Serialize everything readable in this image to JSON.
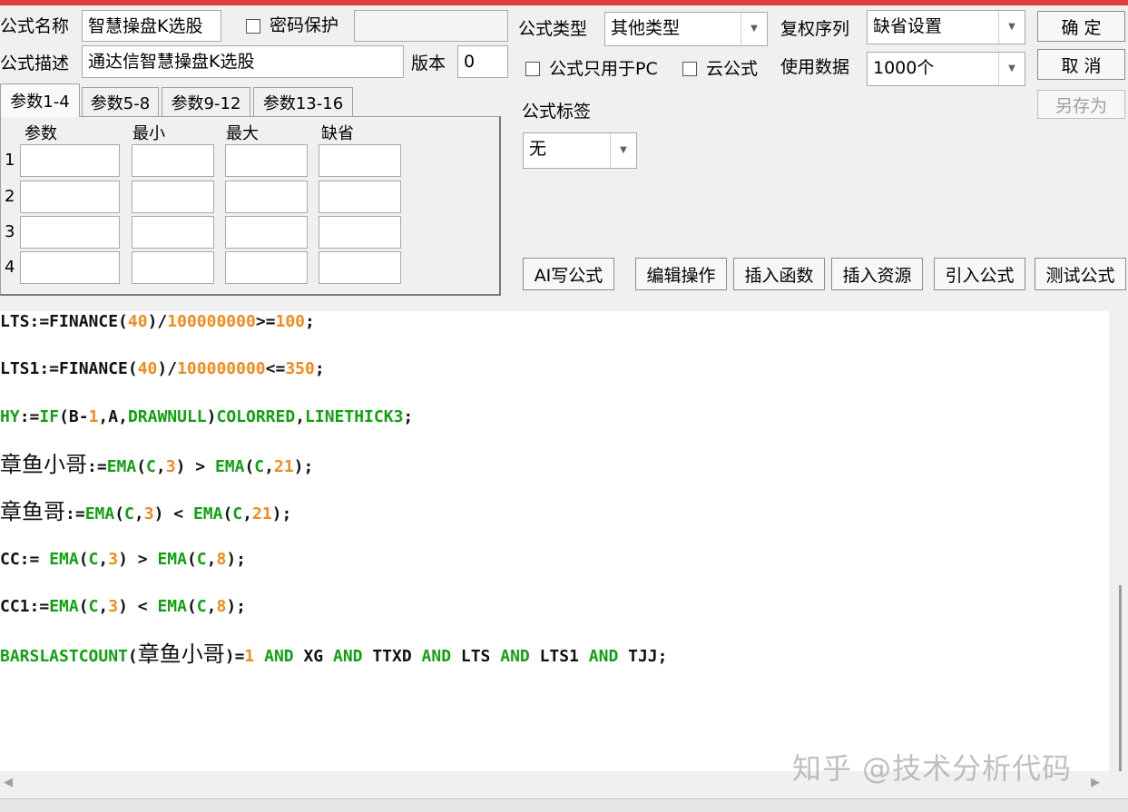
{
  "form": {
    "name_label": "公式名称",
    "name_value": "智慧操盘K选股",
    "password_label": "密码保护",
    "desc_label": "公式描述",
    "desc_value": "通达信智慧操盘K选股",
    "version_label": "版本",
    "version_value": "0",
    "type_label": "公式类型",
    "type_value": "其他类型",
    "fq_label": "复权序列",
    "fq_value": "缺省设置",
    "pc_only_label": "公式只用于PC",
    "cloud_label": "云公式",
    "data_label": "使用数据",
    "data_value": "1000个",
    "tag_label": "公式标签",
    "tag_value": "无"
  },
  "buttons": {
    "ok": "确  定",
    "cancel": "取  消",
    "save_as": "另存为",
    "ai_write": "AI写公式",
    "edit_ops": "编辑操作",
    "insert_func": "插入函数",
    "insert_res": "插入资源",
    "import_formula": "引入公式",
    "test_formula": "测试公式"
  },
  "tabs": [
    "参数1-4",
    "参数5-8",
    "参数9-12",
    "参数13-16"
  ],
  "params": {
    "headers": [
      "参数",
      "最小",
      "最大",
      "缺省"
    ],
    "rows": [
      "1",
      "2",
      "3",
      "4"
    ]
  },
  "code": [
    [
      [
        "p",
        "LTS:=FINANCE("
      ],
      [
        "n",
        "40"
      ],
      [
        "p",
        ")/"
      ],
      [
        "n",
        "100000000"
      ],
      [
        "p",
        ">="
      ],
      [
        "n",
        "100"
      ],
      [
        "p",
        ";"
      ]
    ],
    [
      [
        "p",
        "LTS1:=FINANCE("
      ],
      [
        "n",
        "40"
      ],
      [
        "p",
        ")/"
      ],
      [
        "n",
        "100000000"
      ],
      [
        "p",
        "<="
      ],
      [
        "n",
        "350"
      ],
      [
        "p",
        ";"
      ]
    ],
    [
      [
        "f",
        "HY"
      ],
      [
        "p",
        ":="
      ],
      [
        "f",
        "IF"
      ],
      [
        "p",
        "(B-"
      ],
      [
        "n",
        "1"
      ],
      [
        "p",
        ",A,"
      ],
      [
        "f",
        "DRAWNULL"
      ],
      [
        "p",
        ")"
      ],
      [
        "f",
        "COLORRED"
      ],
      [
        "p",
        ","
      ],
      [
        "f",
        "LINETHICK3"
      ],
      [
        "p",
        ";"
      ]
    ],
    [
      [
        "c",
        "章鱼小哥"
      ],
      [
        "p",
        ":="
      ],
      [
        "f",
        "EMA"
      ],
      [
        "p",
        "("
      ],
      [
        "f",
        "C"
      ],
      [
        "p",
        ","
      ],
      [
        "n",
        "3"
      ],
      [
        "p",
        ") > "
      ],
      [
        "f",
        "EMA"
      ],
      [
        "p",
        "("
      ],
      [
        "f",
        "C"
      ],
      [
        "p",
        ","
      ],
      [
        "n",
        "21"
      ],
      [
        "p",
        ");"
      ]
    ],
    [
      [
        "c",
        "章鱼哥"
      ],
      [
        "p",
        ":="
      ],
      [
        "f",
        "EMA"
      ],
      [
        "p",
        "("
      ],
      [
        "f",
        "C"
      ],
      [
        "p",
        ","
      ],
      [
        "n",
        "3"
      ],
      [
        "p",
        ") < "
      ],
      [
        "f",
        "EMA"
      ],
      [
        "p",
        "("
      ],
      [
        "f",
        "C"
      ],
      [
        "p",
        ","
      ],
      [
        "n",
        "21"
      ],
      [
        "p",
        ");"
      ]
    ],
    [
      [
        "p",
        "CC:= "
      ],
      [
        "f",
        "EMA"
      ],
      [
        "p",
        "("
      ],
      [
        "f",
        "C"
      ],
      [
        "p",
        ","
      ],
      [
        "n",
        "3"
      ],
      [
        "p",
        ") > "
      ],
      [
        "f",
        "EMA"
      ],
      [
        "p",
        "("
      ],
      [
        "f",
        "C"
      ],
      [
        "p",
        ","
      ],
      [
        "n",
        "8"
      ],
      [
        "p",
        ");"
      ]
    ],
    [
      [
        "p",
        "CC1:="
      ],
      [
        "f",
        "EMA"
      ],
      [
        "p",
        "("
      ],
      [
        "f",
        "C"
      ],
      [
        "p",
        ","
      ],
      [
        "n",
        "3"
      ],
      [
        "p",
        ") < "
      ],
      [
        "f",
        "EMA"
      ],
      [
        "p",
        "("
      ],
      [
        "f",
        "C"
      ],
      [
        "p",
        ","
      ],
      [
        "n",
        "8"
      ],
      [
        "p",
        ");"
      ]
    ],
    [
      [
        "f",
        "BARSLASTCOUNT"
      ],
      [
        "p",
        "("
      ],
      [
        "c",
        "章鱼小哥"
      ],
      [
        "p",
        ")="
      ],
      [
        "n",
        "1"
      ],
      [
        "p",
        " "
      ],
      [
        "f",
        "AND"
      ],
      [
        "p",
        " XG "
      ],
      [
        "f",
        "AND"
      ],
      [
        "p",
        " TTXD "
      ],
      [
        "f",
        "AND"
      ],
      [
        "p",
        " LTS "
      ],
      [
        "f",
        "AND"
      ],
      [
        "p",
        " LTS1 "
      ],
      [
        "f",
        "AND"
      ],
      [
        "p",
        " TJJ;"
      ]
    ]
  ],
  "watermark": "知乎 @技术分析代码",
  "colors": {
    "number": "#f08a1c",
    "function": "#12a012",
    "topbar": "#e03a3a"
  }
}
